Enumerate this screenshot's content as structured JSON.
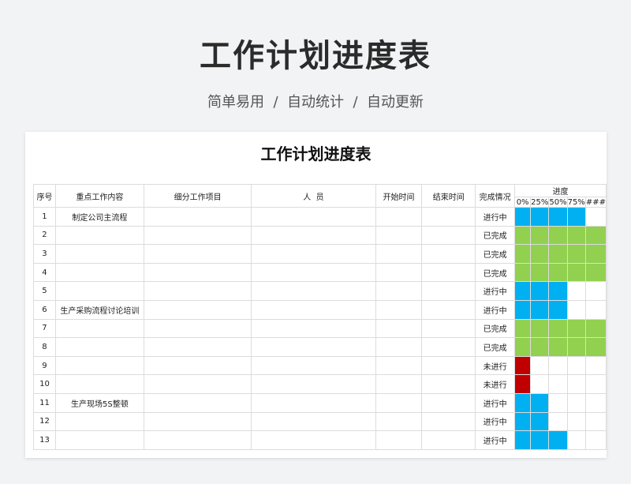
{
  "hero": {
    "title": "工作计划进度表",
    "subtitle": "简单易用  /  自动统计  /  自动更新"
  },
  "sheet": {
    "title": "工作计划进度表",
    "headers": {
      "seq": "序号",
      "key_work": "重点工作内容",
      "sub_items": "细分工作项目",
      "people": "人  员",
      "start": "开始时间",
      "end": "结束时间",
      "status": "完成情况",
      "progress": "进度"
    },
    "progress_ticks": [
      "0%",
      "25%",
      "50%",
      "75%",
      "###"
    ],
    "colors": {
      "done": "#92d050",
      "in_progress": "#00b0f0",
      "not_started": "#c00000"
    },
    "rows": [
      {
        "seq": "1",
        "key_work": "制定公司主流程",
        "status": "进行中",
        "progress": 0.8
      },
      {
        "seq": "2",
        "key_work": "",
        "status": "已完成",
        "progress": 1.0
      },
      {
        "seq": "3",
        "key_work": "",
        "status": "已完成",
        "progress": 1.0
      },
      {
        "seq": "4",
        "key_work": "",
        "status": "已完成",
        "progress": 1.0
      },
      {
        "seq": "5",
        "key_work": "",
        "status": "进行中",
        "progress": 0.6
      },
      {
        "seq": "6",
        "key_work": "生产采购流程讨论培训",
        "status": "进行中",
        "progress": 0.6
      },
      {
        "seq": "7",
        "key_work": "",
        "status": "已完成",
        "progress": 1.0
      },
      {
        "seq": "8",
        "key_work": "",
        "status": "已完成",
        "progress": 1.0
      },
      {
        "seq": "9",
        "key_work": "",
        "status": "未进行",
        "progress": 0.2
      },
      {
        "seq": "10",
        "key_work": "",
        "status": "未进行",
        "progress": 0.2
      },
      {
        "seq": "11",
        "key_work": "生产现场5S整顿",
        "status": "进行中",
        "progress": 0.4
      },
      {
        "seq": "12",
        "key_work": "",
        "status": "进行中",
        "progress": 0.4
      },
      {
        "seq": "13",
        "key_work": "",
        "status": "进行中",
        "progress": 0.6
      }
    ]
  }
}
